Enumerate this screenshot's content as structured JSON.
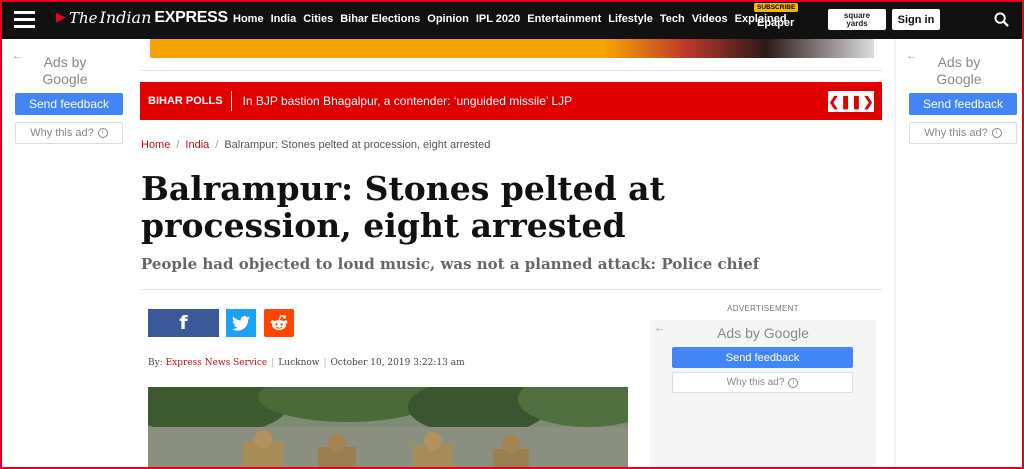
{
  "header": {
    "logo_the": "The",
    "logo_indian": "Indian",
    "logo_express": "EXPRESS",
    "nav": [
      "Home",
      "India",
      "Cities",
      "Bihar Elections",
      "Opinion",
      "IPL 2020",
      "Entertainment",
      "Lifestyle",
      "Tech",
      "Videos",
      "Explained"
    ],
    "epaper": "Epaper",
    "subscribe_badge": "SUBSCRIBE",
    "sq_line1": "square",
    "sq_line2": "yards",
    "signin": "Sign in"
  },
  "side_ads": {
    "ads_by": "Ads by",
    "google": "Google",
    "send_feedback": "Send feedback",
    "why_this_ad": "Why this ad?"
  },
  "ticker": {
    "label": "BIHAR POLLS",
    "headline": "In BJP bastion Bhagalpur, a contender: ‘unguided missile’ LJP"
  },
  "breadcrumb": [
    "Home",
    "India",
    "Balrampur: Stones pelted at procession, eight arrested"
  ],
  "article": {
    "title": "Balrampur: Stones pelted at procession, eight arrested",
    "subtitle": "People had objected to loud music, was not a planned attack: Police chief",
    "byline_prefix": "By:",
    "author": "Express News Service",
    "location": "Lucknow",
    "date": "October 10, 2019 3:22:13 am"
  },
  "advertisement": {
    "label": "ADVERTISEMENT",
    "ads_by_text": "Ads by Google",
    "send_feedback": "Send feedback",
    "why_this_ad": "Why this ad?"
  },
  "colors": {
    "accent_red": "#e00000",
    "link_red": "#b5121b",
    "google_blue": "#4285f4",
    "facebook": "#3b5998",
    "twitter": "#1da1f2",
    "reddit": "#ff4500"
  },
  "icons": [
    "hamburger-icon",
    "search-icon",
    "facebook-icon",
    "twitter-icon",
    "reddit-icon",
    "info-icon",
    "back-arrow-icon"
  ]
}
